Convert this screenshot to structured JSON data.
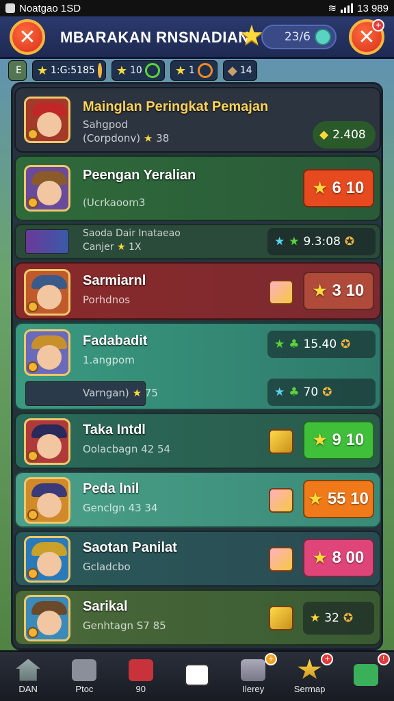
{
  "status": {
    "app": "Noatgao 1SD",
    "time": "13 989"
  },
  "header": {
    "title": "MBARAKAN RNSNADIAN",
    "counter": "23/6",
    "notif": "+"
  },
  "resources": [
    {
      "icon": "E",
      "value": "1:G:5185"
    },
    {
      "icon": "★",
      "value": "10"
    },
    {
      "icon": "★",
      "value": "1"
    },
    {
      "icon": "◆",
      "value": "14"
    }
  ],
  "cards": [
    {
      "name": "Mainglan Peringkat Pemajan",
      "sub1": "Sahgpod",
      "sub2": "(Corpdonv)",
      "stars": "38",
      "price": "2.408"
    },
    {
      "name": "Peengan Yeralian",
      "sub1": "(Ucrkaoom3",
      "price": "6 10"
    },
    {
      "name": "Sarmiarnl",
      "sub1": "Porhdnos",
      "price": "3 10"
    },
    {
      "name": "Fadabadit",
      "sub1": "1.angpom",
      "price": "15.40"
    },
    {
      "name": "Taka Intdl",
      "sub1": "Oolacbagn 42 54",
      "price": "9 10"
    },
    {
      "name": "Peda lnil",
      "sub1": "Genclgn 43 34",
      "price": "55 10"
    },
    {
      "name": "Saotan Panilat",
      "sub1": "Gcladcbo",
      "price": "8 00"
    },
    {
      "name": "Sarikal",
      "sub1": "Genhtagn S7 85",
      "price": "32"
    }
  ],
  "subrows": [
    {
      "line1": "Saoda Dair Inataeao",
      "line2": "Canjer",
      "stars": "1X",
      "chip": "9.3:08"
    },
    {
      "line1": "Varngan)",
      "stars": "75",
      "chip": "70"
    }
  ],
  "nav": [
    {
      "label": "DAN",
      "badge": ""
    },
    {
      "label": "Ptoc",
      "badge": ""
    },
    {
      "label": "90",
      "badge": ""
    },
    {
      "label": "",
      "badge": ""
    },
    {
      "label": "Ilerey",
      "badge": "+"
    },
    {
      "label": "Sermap",
      "badge": "+"
    },
    {
      "label": "",
      "badge": "!"
    }
  ],
  "colors": {
    "red_btn": "#e64a1e",
    "green_btn": "#3fbf3a",
    "orange_btn": "#f07a1a",
    "pink_btn": "#e0457a"
  }
}
